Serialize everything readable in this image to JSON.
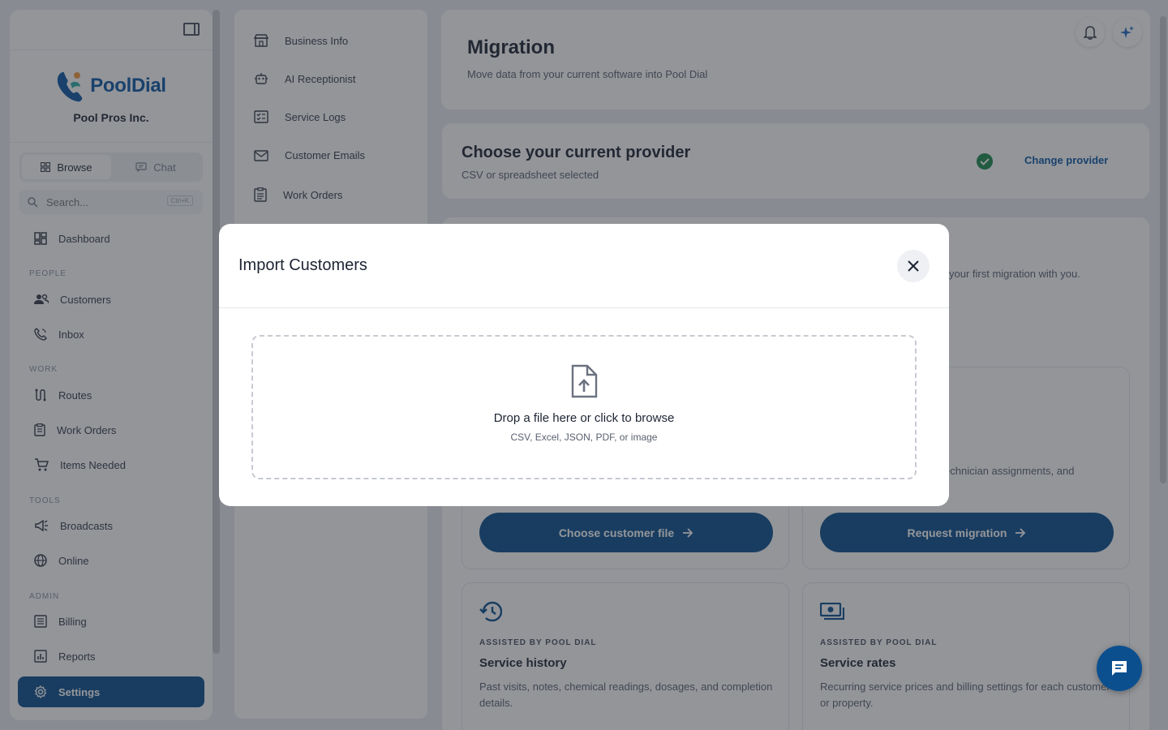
{
  "sidebar": {
    "brand_name": "PoolDial",
    "company": "Pool Pros Inc.",
    "segments": {
      "browse": "Browse",
      "chat": "Chat"
    },
    "search": {
      "placeholder": "Search...",
      "shortcut": "Ctrl+K"
    },
    "dashboard": "Dashboard",
    "sections": {
      "people": "PEOPLE",
      "work": "WORK",
      "tools": "TOOLS",
      "admin": "ADMIN"
    },
    "items": {
      "customers": "Customers",
      "inbox": "Inbox",
      "routes": "Routes",
      "work_orders": "Work Orders",
      "items_needed": "Items Needed",
      "broadcasts": "Broadcasts",
      "online": "Online",
      "billing": "Billing",
      "reports": "Reports",
      "settings": "Settings"
    }
  },
  "settings_nav": {
    "business_info": "Business Info",
    "ai_receptionist": "AI Receptionist",
    "service_logs": "Service Logs",
    "customer_emails": "Customer Emails",
    "work_orders": "Work Orders"
  },
  "header": {
    "title": "Migration",
    "subtitle": "Move data from your current software into Pool Dial"
  },
  "provider": {
    "title": "Choose your current provider",
    "selected": "CSV or spreadsheet selected",
    "change_link": "Change provider"
  },
  "partial": {
    "first_migration": "your first migration with you.",
    "technician": "echnician assignments, and"
  },
  "cards": {
    "choose_file_button": "Choose customer file",
    "request_migration_button": "Request migration",
    "history": {
      "eyebrow": "ASSISTED BY POOL DIAL",
      "title": "Service history",
      "desc": "Past visits, notes, chemical readings, dosages, and completion details."
    },
    "rates": {
      "eyebrow": "ASSISTED BY POOL DIAL",
      "title": "Service rates",
      "desc": "Recurring service prices and billing settings for each customer or property."
    }
  },
  "modal": {
    "title": "Import Customers",
    "drop_title": "Drop a file here or click to browse",
    "drop_sub": "CSV, Excel, JSON, PDF, or image"
  }
}
